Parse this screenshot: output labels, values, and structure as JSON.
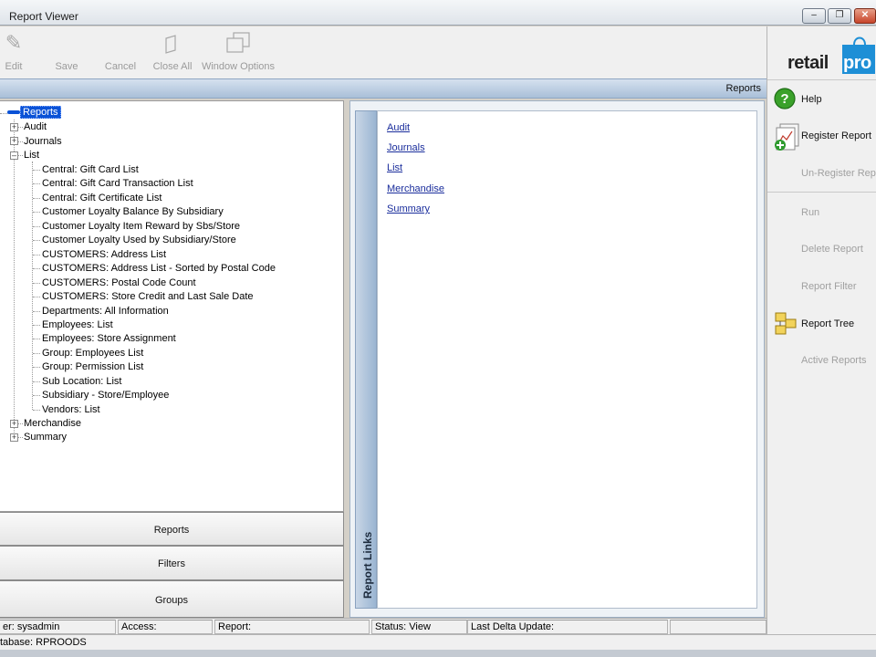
{
  "window": {
    "title": "Report Viewer"
  },
  "toolbar": {
    "edit": "Edit",
    "save": "Save",
    "cancel": "Cancel",
    "close_all": "Close All",
    "window_options": "Window Options"
  },
  "header": {
    "title": "Reports"
  },
  "tree": {
    "root": "Reports",
    "audit": "Audit",
    "journals": "Journals",
    "list": "List",
    "list_children": [
      "Central: Gift Card List",
      "Central: Gift Card Transaction List",
      "Central: Gift Certificate List",
      "Customer Loyalty Balance By Subsidiary",
      "Customer Loyalty Item Reward by Sbs/Store",
      "Customer Loyalty Used by Subsidiary/Store",
      "CUSTOMERS: Address List",
      "CUSTOMERS: Address List - Sorted by Postal Code",
      "CUSTOMERS: Postal Code Count",
      "CUSTOMERS: Store Credit and Last Sale Date",
      "Departments: All Information",
      "Employees: List",
      "Employees: Store Assignment",
      "Group: Employees List",
      "Group: Permission List",
      "Sub Location: List",
      "Subsidiary - Store/Employee",
      "Vendors: List"
    ],
    "merchandise": "Merchandise",
    "summary": "Summary"
  },
  "nav": {
    "reports": "Reports",
    "filters": "Filters",
    "groups": "Groups"
  },
  "links": {
    "strip_title": "Report Links",
    "items": [
      "Audit",
      "Journals",
      "List",
      "Merchandise",
      "Summary"
    ]
  },
  "right": {
    "logo_text_left": "retail",
    "logo_text_right": "pro",
    "help": "Help",
    "register_report": "Register Report",
    "unregister_report": "Un-Register Repo",
    "run": "Run",
    "delete_report": "Delete Report",
    "report_filter": "Report Filter",
    "report_tree": "Report Tree",
    "active_reports": "Active Reports"
  },
  "status": {
    "user": "er: sysadmin",
    "access": "Access:",
    "report": "Report:",
    "status_view": "Status: View",
    "last_delta": "Last Delta Update:",
    "database": "tabase: RPROODS"
  },
  "colors": {
    "link": "#1a2d9c",
    "selection": "#0a52d6",
    "logo_blue": "#1e8fd6"
  }
}
